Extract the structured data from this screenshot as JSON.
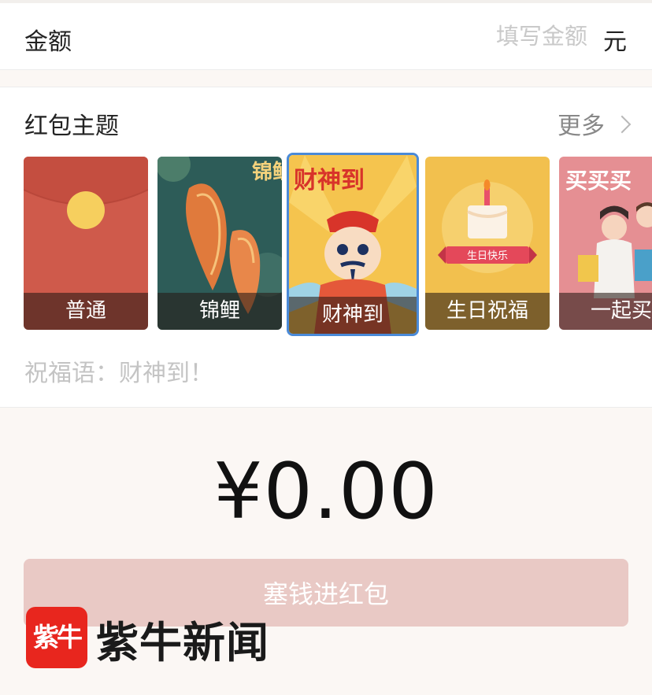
{
  "amount": {
    "label": "金额",
    "placeholder": "填写金额",
    "unit": "元"
  },
  "themes": {
    "title": "红包主题",
    "more": "更多",
    "items": [
      {
        "label": "普通",
        "selected": false
      },
      {
        "label": "锦鲤",
        "selected": false,
        "art_text": "锦鲤"
      },
      {
        "label": "财神到",
        "selected": true,
        "art_text": "财神到"
      },
      {
        "label": "生日祝福",
        "selected": false,
        "art_text": "生日快乐"
      },
      {
        "label": "一起买",
        "selected": false,
        "art_text": "买买买"
      }
    ]
  },
  "blessing": {
    "placeholder": "祝福语：财神到！"
  },
  "total": {
    "value": "¥0.00"
  },
  "submit": {
    "label": "塞钱进红包"
  },
  "watermark": {
    "logo_text": "紫牛",
    "text": "紫牛新闻"
  },
  "colors": {
    "accent_red": "#d0594a",
    "selected_border": "#4a8ad8",
    "button_disabled": "#e9c9c5"
  }
}
